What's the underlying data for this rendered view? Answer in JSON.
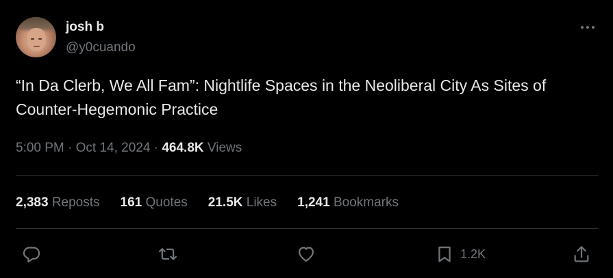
{
  "author": {
    "display_name": "josh b",
    "handle": "@y0cuando"
  },
  "tweet": {
    "text": "“In Da Clerb, We All Fam”: Nightlife Spaces in the Neoliberal City As Sites of Counter-Hegemonic Practice",
    "time": "5:00 PM",
    "separator": "·",
    "date": "Oct 14, 2024",
    "views_count": "464.8K",
    "views_label": "Views"
  },
  "stats": {
    "reposts": {
      "count": "2,383",
      "label": "Reposts"
    },
    "quotes": {
      "count": "161",
      "label": "Quotes"
    },
    "likes": {
      "count": "21.5K",
      "label": "Likes"
    },
    "bookmarks": {
      "count": "1,241",
      "label": "Bookmarks"
    }
  },
  "actions": {
    "reply_icon": "reply-icon",
    "repost_icon": "repost-icon",
    "like_icon": "heart-icon",
    "bookmark_icon": "bookmark-icon",
    "bookmark_count": "1.2K",
    "share_icon": "share-icon",
    "more_icon": "more-icon"
  },
  "colors": {
    "background": "#000000",
    "primary_text": "#e7e9ea",
    "secondary_text": "#71767b",
    "divider": "#2f3336"
  }
}
